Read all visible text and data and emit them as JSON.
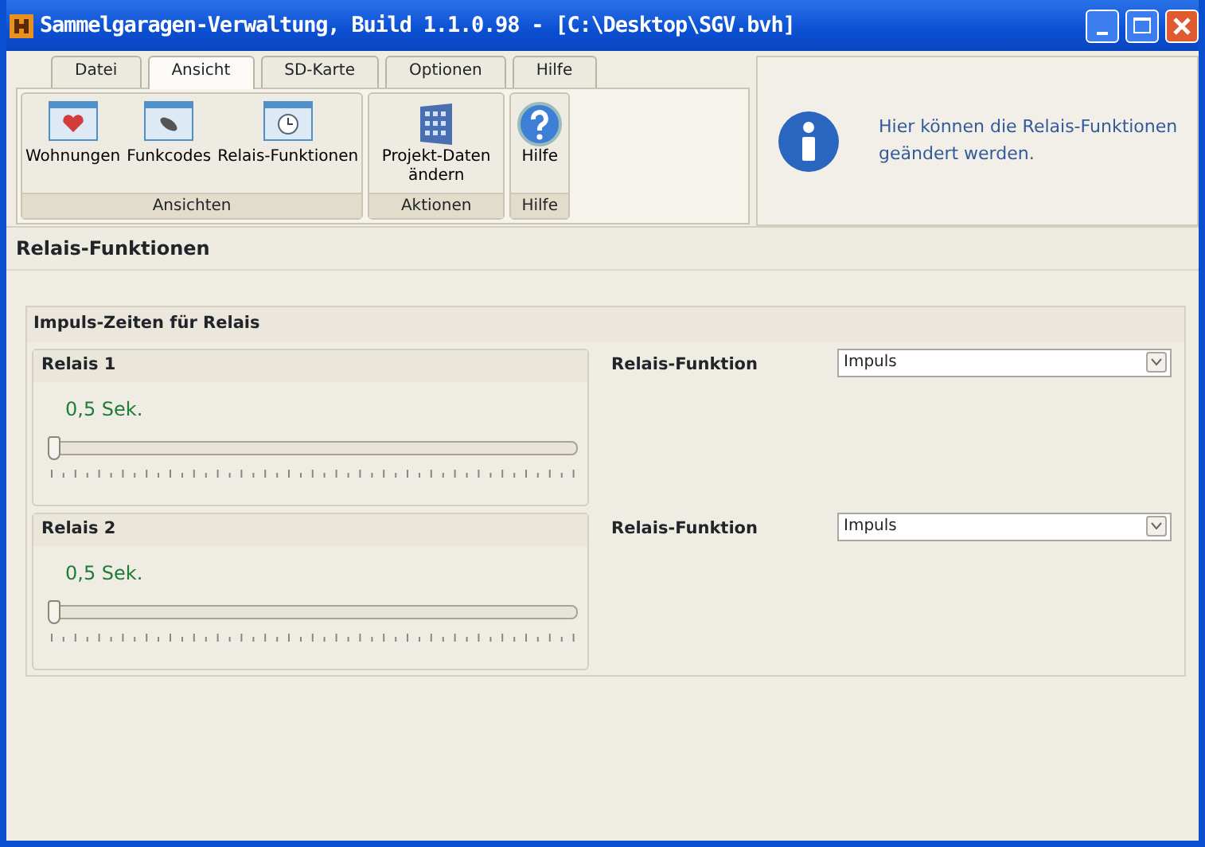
{
  "window": {
    "title": "Sammelgaragen-Verwaltung, Build 1.1.0.98 - [C:\\Desktop\\SGV.bvh]"
  },
  "tabs": [
    {
      "label": "Datei",
      "selected": false
    },
    {
      "label": "Ansicht",
      "selected": true
    },
    {
      "label": "SD-Karte",
      "selected": false
    },
    {
      "label": "Optionen",
      "selected": false
    },
    {
      "label": "Hilfe",
      "selected": false
    }
  ],
  "ribbon_groups": [
    {
      "label": "Ansichten",
      "buttons": [
        {
          "label": "Wohnungen",
          "kind": "heart"
        },
        {
          "label": "Funkcodes",
          "kind": "remote"
        },
        {
          "label": "Relais-Funktionen",
          "kind": "clock"
        }
      ]
    },
    {
      "label": "Aktionen",
      "buttons": [
        {
          "label": "Projekt-Daten ändern",
          "kind": "building"
        }
      ]
    },
    {
      "label": "Hilfe",
      "buttons": [
        {
          "label": "Hilfe",
          "kind": "help"
        }
      ]
    }
  ],
  "info": {
    "text": "Hier können die Relais-Funktionen geändert werden."
  },
  "page_title": "Relais-Funktionen",
  "group": {
    "title": "Impuls-Zeiten für Relais",
    "relays": [
      {
        "title": "Relais 1",
        "reading": "0,5 Sek.",
        "level": 0,
        "function_label": "Relais-Funktion",
        "function_value": "Impuls"
      },
      {
        "title": "Relais 2",
        "reading": "0,5 Sek.",
        "level": 0,
        "function_label": "Relais-Funktion",
        "function_value": "Impuls"
      }
    ]
  }
}
